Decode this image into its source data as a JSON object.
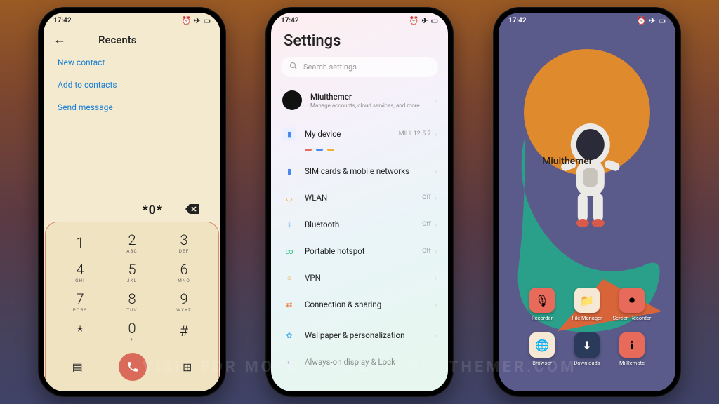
{
  "watermark": "VISIT FOR MORE THEMES - MIUITHEMER.COM",
  "status": {
    "time": "17:42",
    "alarm": "⏰",
    "airplane": "✈",
    "battery": "▭"
  },
  "dialer": {
    "title": "Recents",
    "links": [
      "New contact",
      "Add to contacts",
      "Send message"
    ],
    "typed": "*0*",
    "keys": [
      [
        "1",
        ""
      ],
      [
        "2",
        "ABC"
      ],
      [
        "3",
        "DEF"
      ],
      [
        "4",
        "GHI"
      ],
      [
        "5",
        "JKL"
      ],
      [
        "6",
        "MNO"
      ],
      [
        "7",
        "PQRS"
      ],
      [
        "8",
        "TUV"
      ],
      [
        "9",
        "WXYZ"
      ],
      [
        "*",
        ""
      ],
      [
        "0",
        "+"
      ],
      [
        "#",
        ""
      ]
    ]
  },
  "settings": {
    "heading": "Settings",
    "search_placeholder": "Search settings",
    "account": {
      "name": "Miuithemer",
      "sub": "Manage accounts, cloud services, and more"
    },
    "mydevice": {
      "label": "My device",
      "meta": "MIUI 12.5.7"
    },
    "items": [
      {
        "label": "SIM cards & mobile networks",
        "meta": "",
        "color": "#4a88f0"
      },
      {
        "label": "WLAN",
        "meta": "Off",
        "color": "#f0a030"
      },
      {
        "label": "Bluetooth",
        "meta": "Off",
        "color": "#5a9df0"
      },
      {
        "label": "Portable hotspot",
        "meta": "Off",
        "color": "#30c080"
      },
      {
        "label": "VPN",
        "meta": "",
        "color": "#f0a030"
      },
      {
        "label": "Connection & sharing",
        "meta": "",
        "color": "#f07030"
      },
      {
        "label": "Wallpaper & personalization",
        "meta": "",
        "color": "#4ab0f0"
      },
      {
        "label": "Always-on display & Lock",
        "meta": "",
        "color": "#a060f0"
      }
    ]
  },
  "home": {
    "overlay": "Miuithemer",
    "apps": [
      {
        "label": "Recorder",
        "glyph": "🎙",
        "bg": "#e86a5a"
      },
      {
        "label": "File Manager",
        "glyph": "📁",
        "bg": "#f5e9d6"
      },
      {
        "label": "Screen Recorder",
        "glyph": "⏺",
        "bg": "#e86a5a"
      },
      {
        "label": "Browser",
        "glyph": "🌐",
        "bg": "#f5e9d6"
      },
      {
        "label": "Downloads",
        "glyph": "⬇",
        "bg": "#2a3a5a"
      },
      {
        "label": "Mi Remote",
        "glyph": "ℹ",
        "bg": "#e86a5a"
      }
    ]
  }
}
